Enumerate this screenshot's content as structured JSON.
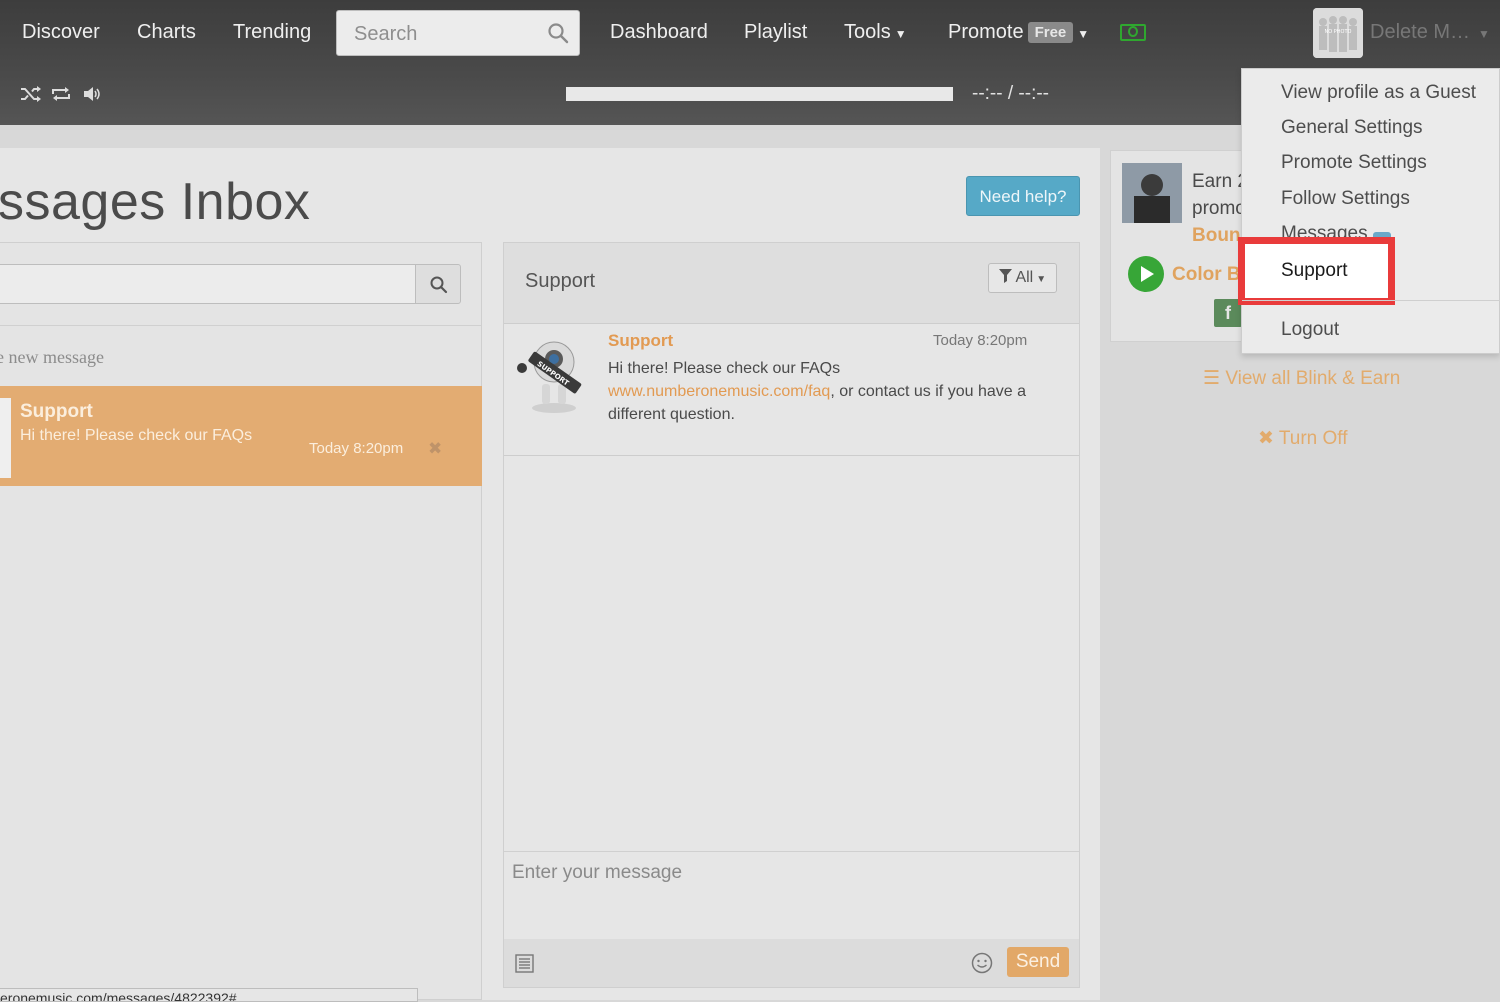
{
  "nav": {
    "discover": "Discover",
    "charts": "Charts",
    "trending": "Trending",
    "search_placeholder": "Search",
    "dashboard": "Dashboard",
    "playlist": "Playlist",
    "tools": "Tools",
    "promote": "Promote",
    "promote_badge": "Free",
    "user_name": "Delete M…",
    "avatar_label": "NO PHOTO"
  },
  "player": {
    "timer": "--:-- / --:--",
    "progress": 1.0
  },
  "page": {
    "title": "ssages Inbox",
    "need_help": "Need help?",
    "new_message": "e new message"
  },
  "inbox_list": [
    {
      "name": "Support",
      "preview": "Hi there! Please check our FAQs",
      "time": "Today 8:20pm"
    }
  ],
  "conversation": {
    "title": "Support",
    "filter": "All",
    "message": {
      "sender": "Support",
      "time": "Today 8:20pm",
      "text_before": "Hi there! Please check our FAQs",
      "link": "www.numberonemusic.com/faq",
      "text_after": ", or contact us if you have a different question.",
      "avatar_label": "SUPPORT"
    },
    "input_placeholder": "Enter your message",
    "send": "Send"
  },
  "status_url": "eronemusic.com/messages/4822392#",
  "promo": {
    "line1": "Earn 2",
    "line2": "promo",
    "line3": "Boun",
    "color_label": "Color B",
    "fb": "f",
    "view_all": "View all Blink & Earn",
    "turn_off": "Turn Off"
  },
  "user_menu": {
    "items": [
      "View profile as a Guest",
      "General Settings",
      "Promote Settings",
      "Follow Settings",
      "Messages",
      "Support",
      "Logout"
    ]
  },
  "colors": {
    "accent_orange": "#e3ac72",
    "highlight_red": "#e93b3b",
    "help_blue": "#56a9c7",
    "money_green": "#2fa72f"
  }
}
